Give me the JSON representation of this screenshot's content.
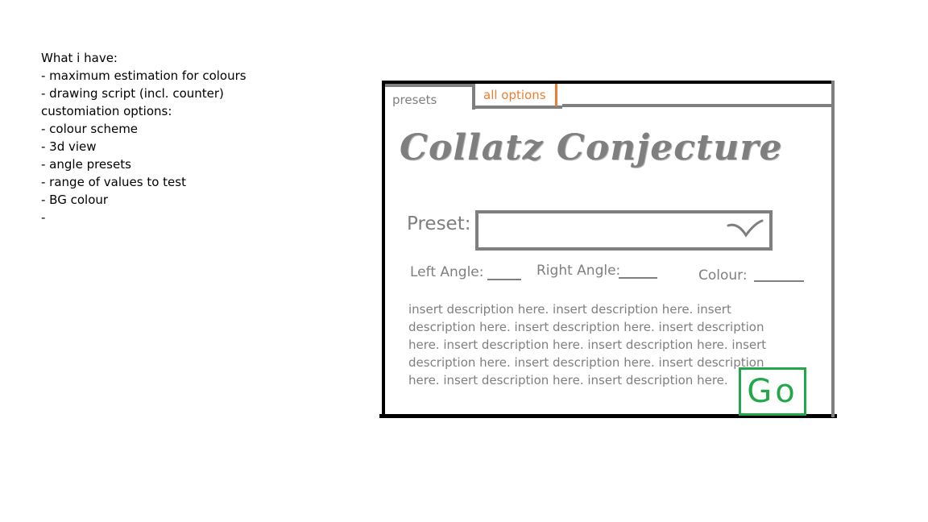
{
  "notes": {
    "lines": [
      "What i have:",
      "- maximum estimation for colours",
      "- drawing script (incl. counter)",
      "customiation options:",
      "- colour scheme",
      "- 3d view",
      "- angle presets",
      "- range of values to test",
      "- BG colour",
      "-"
    ]
  },
  "mockup": {
    "tabs": [
      {
        "label": "presets",
        "active": true
      },
      {
        "label": "all options",
        "active": false
      }
    ],
    "title": "Collatz Conjecture",
    "preset_label": "Preset:",
    "fields": {
      "left_angle": "Left Angle:",
      "right_angle": "Right Angle:",
      "colour": "Colour:"
    },
    "description": "insert description here. insert description here. insert description here. insert description here. insert description here. insert description here. insert description here. insert description here. insert description here. insert description here. insert description here. insert description here.",
    "go_label": "Go",
    "colors": {
      "frame": "#000000",
      "inner": "#7f7f7f",
      "tab_accent": "#ed7d31",
      "go": "#22a84a"
    }
  }
}
